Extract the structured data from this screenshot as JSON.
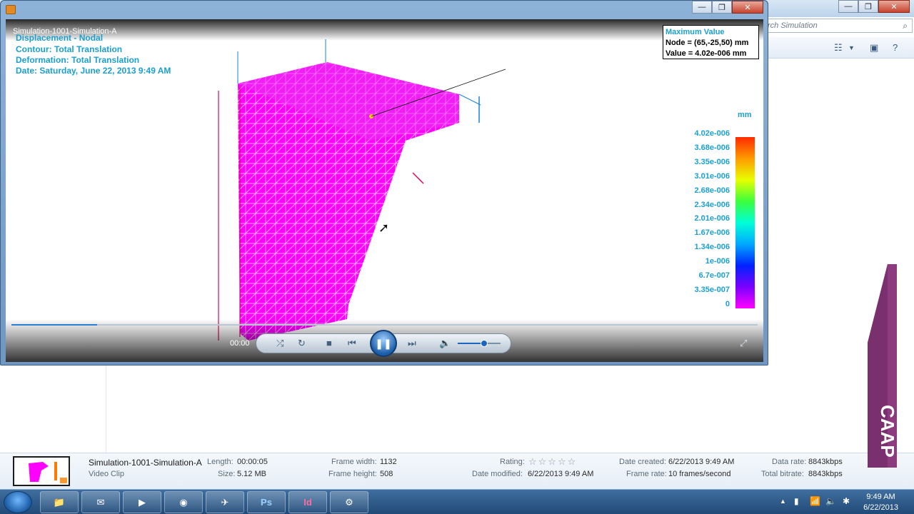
{
  "explorer": {
    "search_placeholder": "rch Simulation"
  },
  "details": {
    "file_name": "Simulation-1001-Simulation-A",
    "file_type": "Video Clip",
    "length_label": "Length:",
    "length_value": "00:00:05",
    "size_label": "Size:",
    "size_value": "5.12 MB",
    "frame_width_label": "Frame width:",
    "frame_width_value": "1132",
    "frame_height_label": "Frame height:",
    "frame_height_value": "508",
    "rating_label": "Rating:",
    "rating_value": 0,
    "rating_stars": "☆☆☆☆☆",
    "date_modified_label": "Date modified:",
    "date_modified_value": "6/22/2013 9:49 AM",
    "date_created_label": "Date created:",
    "date_created_value": "6/22/2013 9:49 AM",
    "frame_rate_label": "Frame rate:",
    "frame_rate_value": "10 frames/second",
    "data_rate_label": "Data rate:",
    "data_rate_value": "8843kbps",
    "total_bitrate_label": "Total bitrate:",
    "total_bitrate_value": "8843kbps"
  },
  "player": {
    "video_title": "Simulation-1001-Simulation-A",
    "overlay_lines": [
      "Displacement - Nodal",
      "Contour: Total Translation",
      "Deformation: Total Translation",
      "Date: Saturday, June 22, 2013  9:49 AM"
    ],
    "max_box": {
      "title": "Maximum Value",
      "node": "Node = (65,-25,50) mm",
      "value": "Value = 4.02e-006 mm"
    },
    "legend_unit": "mm",
    "legend_ticks": [
      "4.02e-006",
      "3.68e-006",
      "3.35e-006",
      "3.01e-006",
      "2.68e-006",
      "2.34e-006",
      "2.01e-006",
      "1.67e-006",
      "1.34e-006",
      "1e-006",
      "6.7e-007",
      "3.35e-007",
      "0"
    ],
    "time": "00:00",
    "seek_progress": 0.115,
    "volume_level": 0.62
  },
  "banner": {
    "text": "CAAP"
  },
  "taskbar": {
    "apps": [
      "explorer",
      "outlook",
      "media-player",
      "firefox",
      "app",
      "Ps",
      "Id",
      "app2"
    ],
    "ps_label": "Ps",
    "id_label": "Id",
    "clock_time": "9:49 AM",
    "clock_date": "6/22/2013"
  },
  "colors": {
    "overlay_text": "#1a9fcf",
    "mesh_magenta": "#ff00ff",
    "taskbar": "#214a78"
  }
}
